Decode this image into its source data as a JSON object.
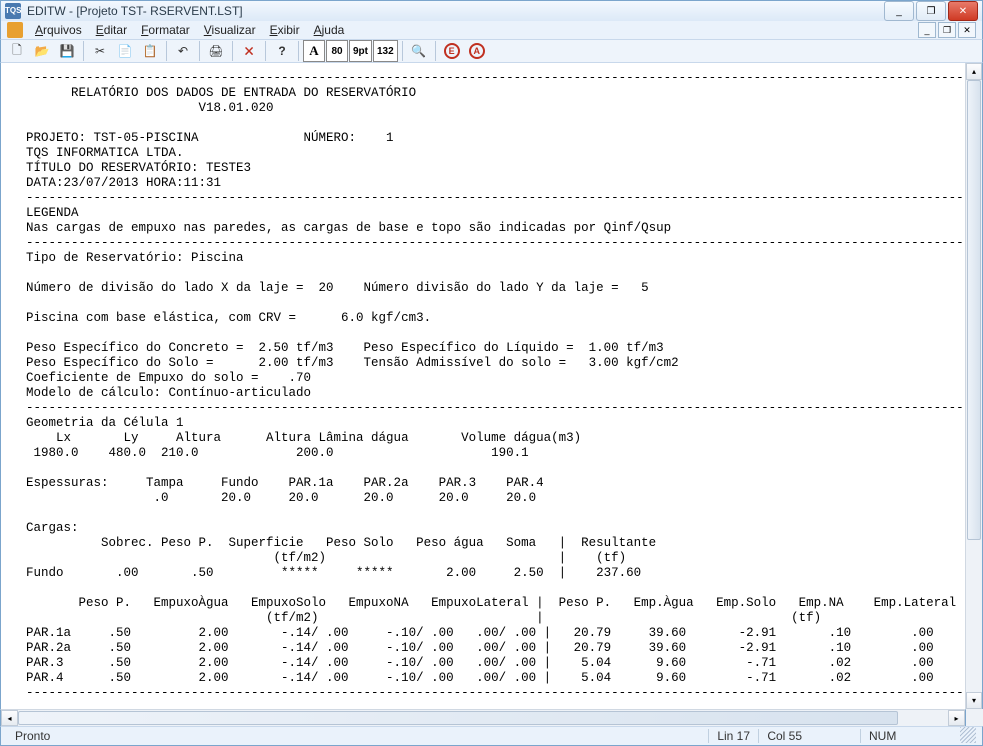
{
  "title": "EDITW - [Projeto TST- RSERVENT.LST]",
  "app_icon_label": "TQS",
  "window_buttons": {
    "min": "_",
    "max": "❐",
    "close": "✕"
  },
  "mdi_buttons": {
    "min": "_",
    "restore": "❐",
    "close": "✕"
  },
  "menubar": {
    "arquivos": "Arquivos",
    "editar": "Editar",
    "formatar": "Formatar",
    "visualizar": "Visualizar",
    "exibir": "Exibir",
    "ajuda": "Ajuda"
  },
  "toolbar": {
    "new": "🗋",
    "open": "📂",
    "save": "💾",
    "cut": "✂",
    "copy": "📄",
    "paste": "📋",
    "undo": "↶",
    "print": "🖨",
    "close": "🗙",
    "help": "?",
    "font": "A",
    "t80": "80",
    "t9pt": "9pt",
    "t132": "132",
    "find": "🔍",
    "e": "E",
    "a": "A"
  },
  "doc": [
    "  ----------------------------------------------------------------------------------------------------------------------------------",
    "        RELATÓRIO DOS DADOS DE ENTRADA DO RESERVATÓRIO",
    "                         V18.01.020",
    "",
    "  PROJETO: TST-05-PISCINA              NÚMERO:    1",
    "  TQS INFORMATICA LTDA.",
    "  TÍTULO DO RESERVATÓRIO: TESTE3",
    "  DATA:23/07/2013 HORA:11:31",
    "  ----------------------------------------------------------------------------------------------------------------------------------",
    "  LEGENDA",
    "  Nas cargas de empuxo nas paredes, as cargas de base e topo são indicadas por Qinf/Qsup",
    "  ----------------------------------------------------------------------------------------------------------------------------------",
    "  Tipo de Reservatório: Piscina",
    "",
    "  Número de divisão do lado X da laje =  20    Número divisão do lado Y da laje =   5",
    "",
    "  Piscina com base elástica, com CRV =      6.0 kgf/cm3.",
    "",
    "  Peso Específico do Concreto =  2.50 tf/m3    Peso Específico do Líquido =  1.00 tf/m3",
    "  Peso Específico do Solo =      2.00 tf/m3    Tensão Admissível do solo =   3.00 kgf/cm2",
    "  Coeficiente de Empuxo do solo =    .70",
    "  Modelo de cálculo: Contínuo-articulado",
    "  ----------------------------------------------------------------------------------------------------------------------------------",
    "  Geometria da Célula 1",
    "      Lx       Ly     Altura      Altura Lâmina dágua       Volume dágua(m3)",
    "   1980.0    480.0  210.0             200.0                     190.1",
    "",
    "  Espessuras:     Tampa     Fundo    PAR.1a    PAR.2a    PAR.3    PAR.4",
    "                   .0       20.0     20.0      20.0      20.0     20.0",
    "",
    "  Cargas:",
    "            Sobrec. Peso P.  Superficie   Peso Solo   Peso água   Soma   |  Resultante",
    "                                   (tf/m2)                               |    (tf)",
    "  Fundo       .00       .50         *****     *****       2.00     2.50  |    237.60",
    "",
    "         Peso P.   EmpuxoÀgua   EmpuxoSolo   EmpuxoNA   EmpuxoLateral |  Peso P.   Emp.Àgua   Emp.Solo   Emp.NA    Emp.Lateral",
    "                                  (tf/m2)                             |                                 (tf)",
    "  PAR.1a     .50         2.00       -.14/ .00     -.10/ .00   .00/ .00 |   20.79     39.60       -2.91       .10        .00",
    "  PAR.2a     .50         2.00       -.14/ .00     -.10/ .00   .00/ .00 |   20.79     39.60       -2.91       .10        .00",
    "  PAR.3      .50         2.00       -.14/ .00     -.10/ .00   .00/ .00 |    5.04      9.60        -.71       .02        .00",
    "  PAR.4      .50         2.00       -.14/ .00     -.10/ .00   .00/ .00 |    5.04      9.60        -.71       .02        .00",
    "  ----------------------------------------------------------------------------------------------------------------------------------"
  ],
  "status": {
    "ready": "Pronto",
    "line": "Lin 17",
    "col": "Col 55",
    "num": "NUM"
  }
}
